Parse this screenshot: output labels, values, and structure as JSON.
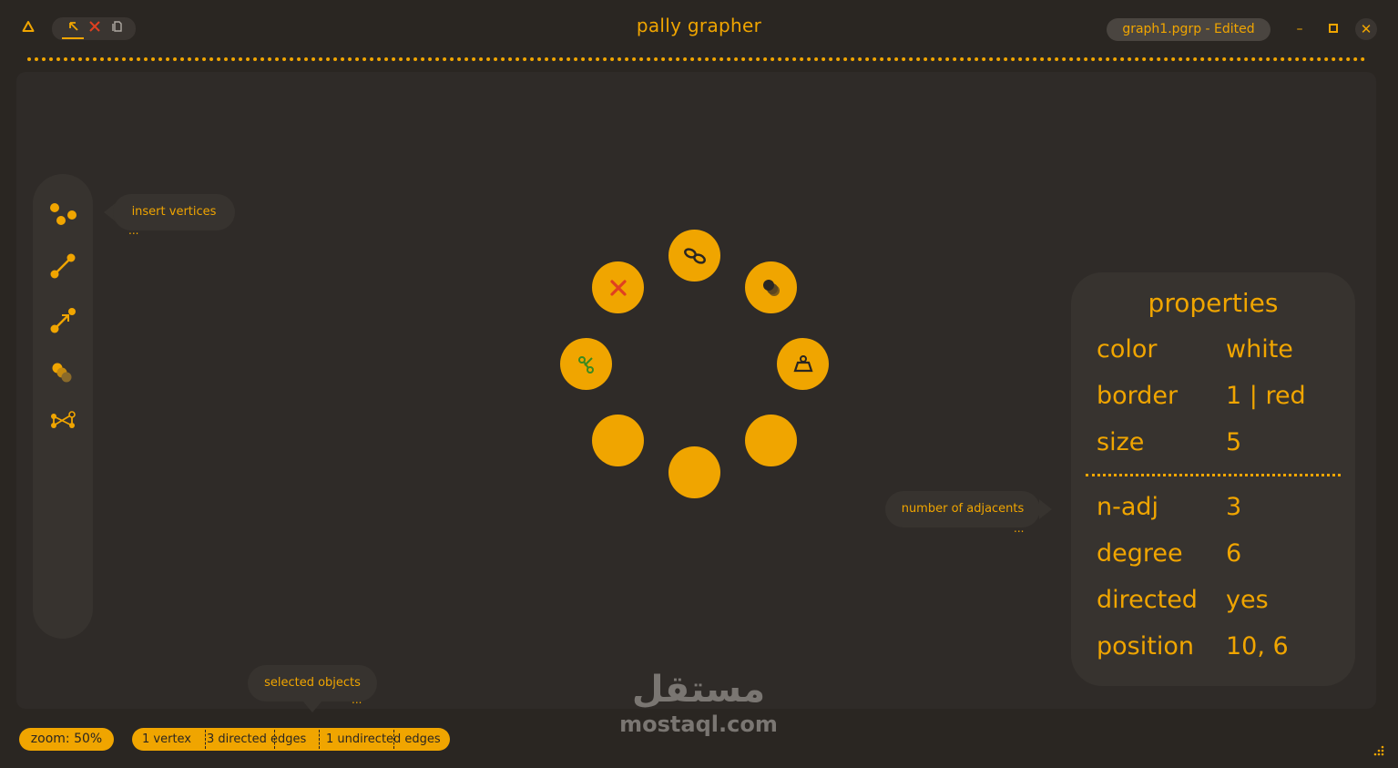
{
  "app": {
    "title": "pally grapher",
    "file_label": "graph1.pgrp - Edited",
    "accent_color": "#f0a500",
    "background_color": "#2a2622"
  },
  "titlebar": {
    "tools": [
      "select-arrow-icon",
      "close-x-icon",
      "copy-icon"
    ],
    "window_buttons": [
      "minimize-icon",
      "maximize-icon",
      "close-icon"
    ],
    "minimize_glyph": "–",
    "maximize_glyph": "□",
    "close_glyph": "✕"
  },
  "toolbar": {
    "items": [
      "insert-vertices-icon",
      "insert-edge-icon",
      "insert-directed-edge-icon",
      "group-vertices-icon",
      "graph-icon"
    ]
  },
  "tooltips": {
    "insert": {
      "label": "insert vertices",
      "dots": "..."
    },
    "adjacent": {
      "label": "number of adjacents",
      "dots": "..."
    },
    "selected": {
      "label": "selected objects",
      "dots": "..."
    }
  },
  "radial_menu": {
    "items": [
      "link-icon",
      "shadow-icon",
      "weight-icon",
      "empty",
      "empty",
      "empty",
      "cut-icon",
      "delete-icon"
    ]
  },
  "properties": {
    "title": "properties",
    "visual": [
      {
        "key": "color",
        "value": "white"
      },
      {
        "key": "border",
        "value": "1 | red"
      },
      {
        "key": "size",
        "value": "5"
      }
    ],
    "graph": [
      {
        "key": "n-adj",
        "value": "3"
      },
      {
        "key": "degree",
        "value": "6"
      },
      {
        "key": "directed",
        "value": "yes"
      },
      {
        "key": "position",
        "value": "10, 6"
      }
    ]
  },
  "statusbar": {
    "zoom": "zoom: 50%",
    "vertex_count": "1 vertex",
    "directed_edges": "3 directed edges",
    "undirected_edges": "1 undirected edges"
  },
  "watermark": {
    "arabic": "مستقل",
    "latin": "mostaql.com"
  }
}
